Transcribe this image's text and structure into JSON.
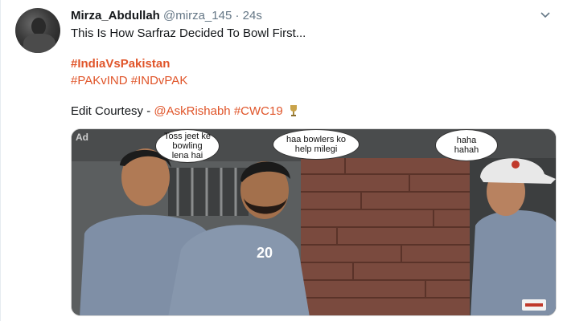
{
  "tweet": {
    "author_name": "Mirza_Abdullah",
    "author_handle": "@mirza_145",
    "separator": "·",
    "time": "24s",
    "line1": "This Is How Sarfraz Decided To Bowl First...",
    "hashtag_main": "#IndiaVsPakistan",
    "hashtags_secondary": "#PAKvIND #INDvPAK",
    "courtesy_prefix": "Edit Courtesy - ",
    "courtesy_mention": "@AskRishabh",
    "courtesy_hashtag": " #CWC19",
    "trophy_icon": "trophy-icon",
    "chevron_icon": "chevron-down-icon"
  },
  "media": {
    "ad_label": "Ad",
    "bubble1": "Toss jeet ke\nbowling\nlena hai",
    "bubble2": "haa bowlers ko\nhelp milegi",
    "bubble3": "haha\nhahah",
    "jersey_number": "20",
    "colors": {
      "wall": "#5b5e5f",
      "brick": "#7a4a3e",
      "kurta": "#7f8fa6",
      "cap": "#e8e8e8",
      "skin": "#b07a55"
    }
  },
  "colors": {
    "hashtag": "#e0552a",
    "muted": "#657786",
    "text": "#14171a"
  }
}
